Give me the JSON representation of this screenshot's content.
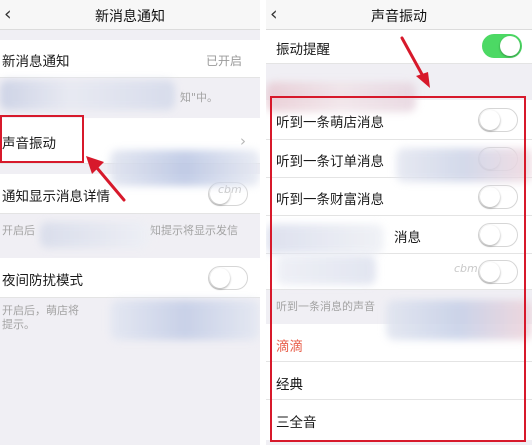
{
  "left_screen": {
    "back_icon": "chevron-left-icon",
    "title": "新消息通知",
    "new_msg": {
      "label": "新消息通知",
      "value": "已开启"
    },
    "new_msg_hint": "知\"中。",
    "sound_vibrate": {
      "label": "声音振动",
      "chevron": "›"
    },
    "show_detail": {
      "label": "通知显示消息详情",
      "on": false
    },
    "show_detail_hint_left": "开启后",
    "show_detail_hint_right": "知提示将显示发信",
    "watermark": "cbm",
    "night_mode": {
      "label": "夜间防扰模式",
      "on": false
    },
    "night_hint_line1": "开启后，萌店将",
    "night_hint_line2": "提示。"
  },
  "right_screen": {
    "back_icon": "chevron-left-icon",
    "title": "声音振动",
    "vibrate": {
      "label": "振动提醒",
      "on": true
    },
    "sound_rows": [
      {
        "label": "听到一条萌店消息",
        "on": false
      },
      {
        "label": "听到一条订单消息",
        "on": false
      },
      {
        "label": "听到一条财富消息",
        "on": false
      },
      {
        "label": "消息",
        "on": false
      },
      {
        "label": "",
        "on": false
      }
    ],
    "watermark": "cbm",
    "section_hint": "听到一条消息的声音",
    "sound_options": [
      {
        "label": "滴滴",
        "selected": true
      },
      {
        "label": "经典",
        "selected": false
      },
      {
        "label": "三全音",
        "selected": false
      }
    ]
  },
  "colors": {
    "accent_red": "#d7192b",
    "switch_on": "#4cd964",
    "selected_option": "#e8604c"
  }
}
